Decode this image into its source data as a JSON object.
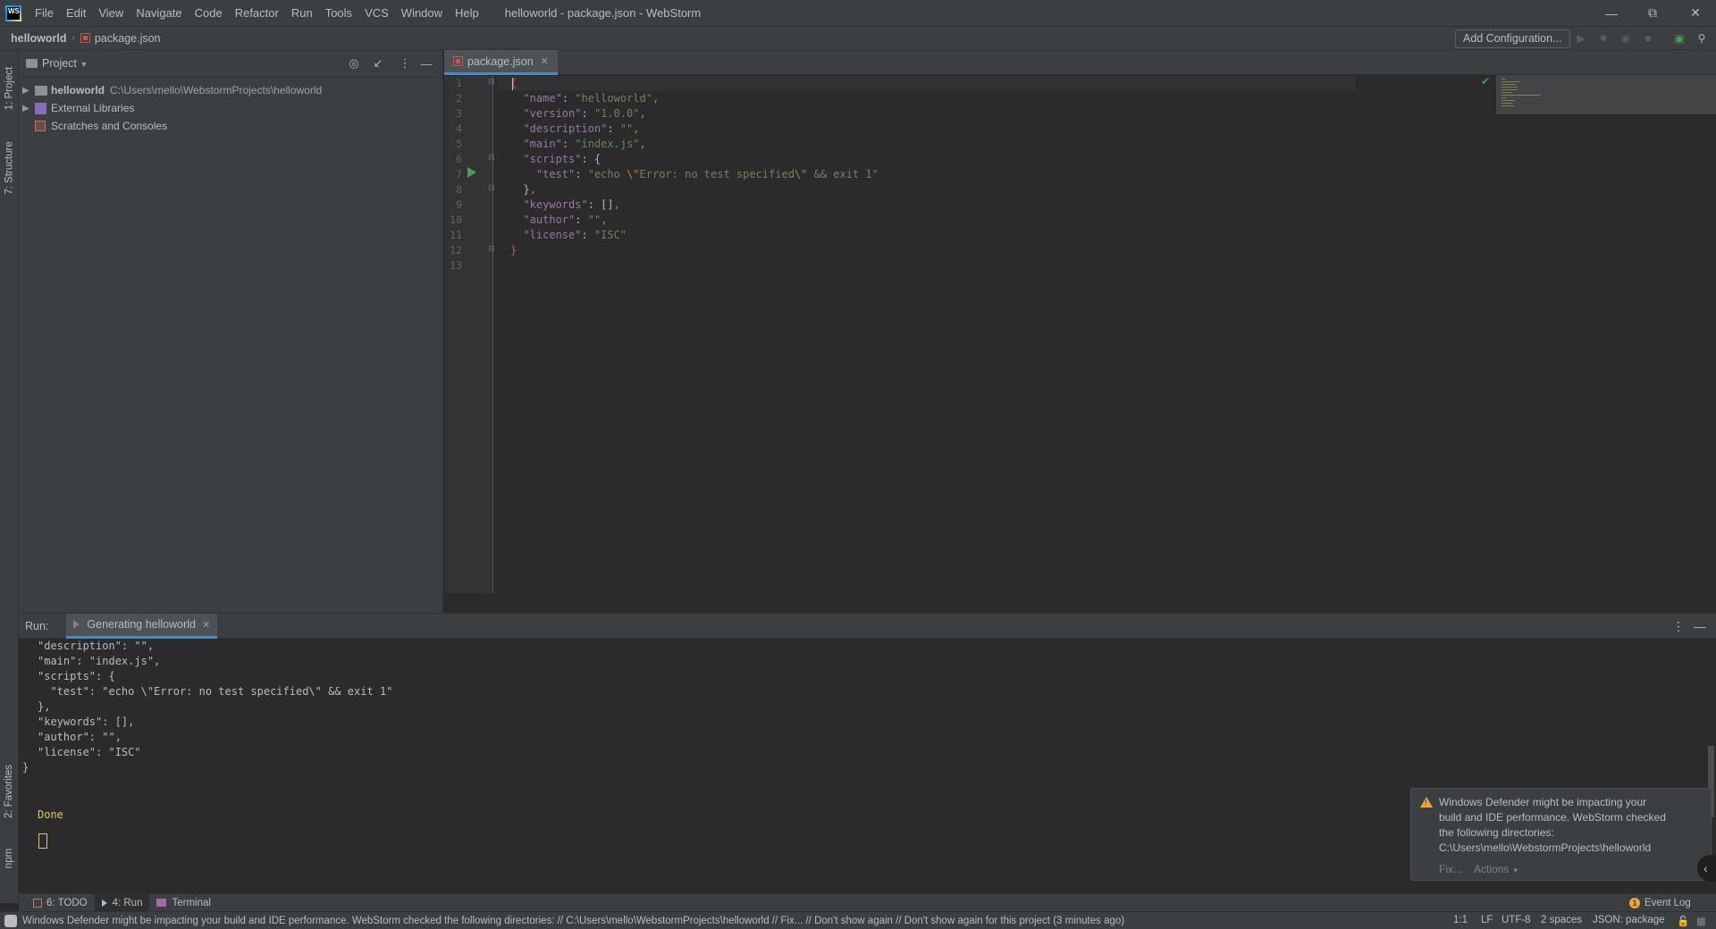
{
  "app": {
    "title": "helloworld - package.json - WebStorm",
    "logo_text": "WS",
    "menu": [
      "File",
      "Edit",
      "View",
      "Navigate",
      "Code",
      "Refactor",
      "Run",
      "Tools",
      "VCS",
      "Window",
      "Help"
    ]
  },
  "navbar": {
    "project": "helloworld",
    "file": "package.json",
    "add_configuration": "Add Configuration..."
  },
  "left_strip": {
    "project_tab": "1: Project",
    "structure_tab": "7: Structure",
    "favorites_tab": "2: Favorites",
    "npm_tab": "npm"
  },
  "project_panel": {
    "title": "Project",
    "tree": [
      {
        "name": "helloworld",
        "path": "C:\\Users\\mello\\WebstormProjects\\helloworld"
      },
      {
        "name": "External Libraries"
      },
      {
        "name": "Scratches and Consoles"
      }
    ]
  },
  "editor": {
    "tab": "package.json",
    "line_numbers": [
      "1",
      "2",
      "3",
      "4",
      "5",
      "6",
      "7",
      "8",
      "9",
      "10",
      "11",
      "12",
      "13"
    ],
    "lines": [
      "{",
      "  \"name\": \"helloworld\",",
      "  \"version\": \"1.0.0\",",
      "  \"description\": \"\",",
      "  \"main\": \"index.js\",",
      "  \"scripts\": {",
      "    \"test\": \"echo \\\"Error: no test specified\\\" && exit 1\"",
      "  },",
      "  \"keywords\": [],",
      "  \"author\": \"\",",
      "  \"license\": \"ISC\"",
      "}",
      ""
    ]
  },
  "run_panel": {
    "label": "Run:",
    "tab": "Generating helloworld",
    "console": [
      "\"description\": \"\",",
      "\"main\": \"index.js\",",
      "\"scripts\": {",
      "  \"test\": \"echo \\\"Error: no test specified\\\" && exit 1\"",
      "},",
      "\"keywords\": [],",
      "\"author\": \"\",",
      "\"license\": \"ISC\"",
      "}",
      "",
      "",
      "Done"
    ]
  },
  "notification": {
    "lines": [
      "Windows Defender might be impacting your",
      "build and IDE performance. WebStorm checked",
      "the following directories:",
      "C:\\Users\\mello\\WebstormProjects\\helloworld"
    ],
    "fix": "Fix...",
    "actions": "Actions"
  },
  "bottom_bar": {
    "todo": "6: TODO",
    "run": "4: Run",
    "terminal": "Terminal",
    "event_log": "Event Log",
    "event_log_badge": "1"
  },
  "status_bar": {
    "message": "Windows Defender might be impacting your build and IDE performance. WebStorm checked the following directories: // C:\\Users\\mello\\WebstormProjects\\helloworld // Fix... // Don't show again // Don't show again for this project (3 minutes ago)",
    "position": "1:1",
    "line_sep": "LF",
    "encoding": "UTF-8",
    "indent": "2 spaces",
    "schema": "JSON: package"
  },
  "colors": {
    "bg": "#2b2b2b",
    "panel": "#3c3f41",
    "accent": "#4a88c7",
    "json_key": "#9876aa",
    "json_string": "#6a8759",
    "warning": "#f0a732",
    "run_green": "#499c54"
  }
}
